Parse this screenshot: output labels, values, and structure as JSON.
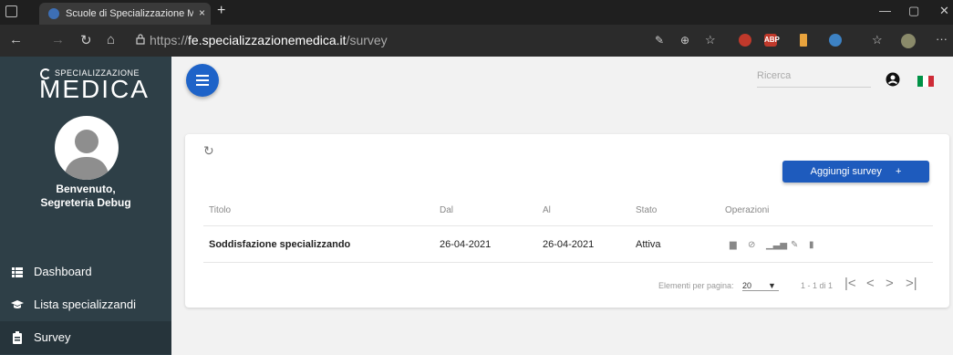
{
  "browser": {
    "tab_title": "Scuole di Specializzazione Medic",
    "tab_close": "×",
    "new_tab": "+",
    "url_scheme": "https://",
    "url_host": "fe.specializzazionemedica.it",
    "url_path": "/survey",
    "ext_abp": "ABP"
  },
  "sidebar": {
    "logo_small": "SPECIALIZZAZIONE",
    "logo_big": "MEDICA",
    "welcome_line1": "Benvenuto,",
    "welcome_line2": "Segreteria Debug",
    "items": [
      {
        "label": "Dashboard",
        "icon": "dashboard-icon"
      },
      {
        "label": "Lista specializzandi",
        "icon": "graduation-cap-icon"
      },
      {
        "label": "Survey",
        "icon": "clipboard-icon",
        "active": true
      }
    ]
  },
  "header": {
    "search_placeholder": "Ricerca"
  },
  "survey": {
    "add_button": "Aggiungi survey",
    "add_plus": "+",
    "columns": [
      "Titolo",
      "Dal",
      "Al",
      "Stato",
      "Operazioni"
    ],
    "rows": [
      {
        "titolo": "Soddisfazione specializzando",
        "dal": "26-04-2021",
        "al": "26-04-2021",
        "stato": "Attiva"
      }
    ],
    "paginator": {
      "items_per_page_label": "Elementi per pagina:",
      "items_per_page_value": "20",
      "range_label": "1 - 1 di 1"
    }
  },
  "colors": {
    "sidebar_bg": "#2e3f47",
    "primary": "#1e63c8"
  }
}
